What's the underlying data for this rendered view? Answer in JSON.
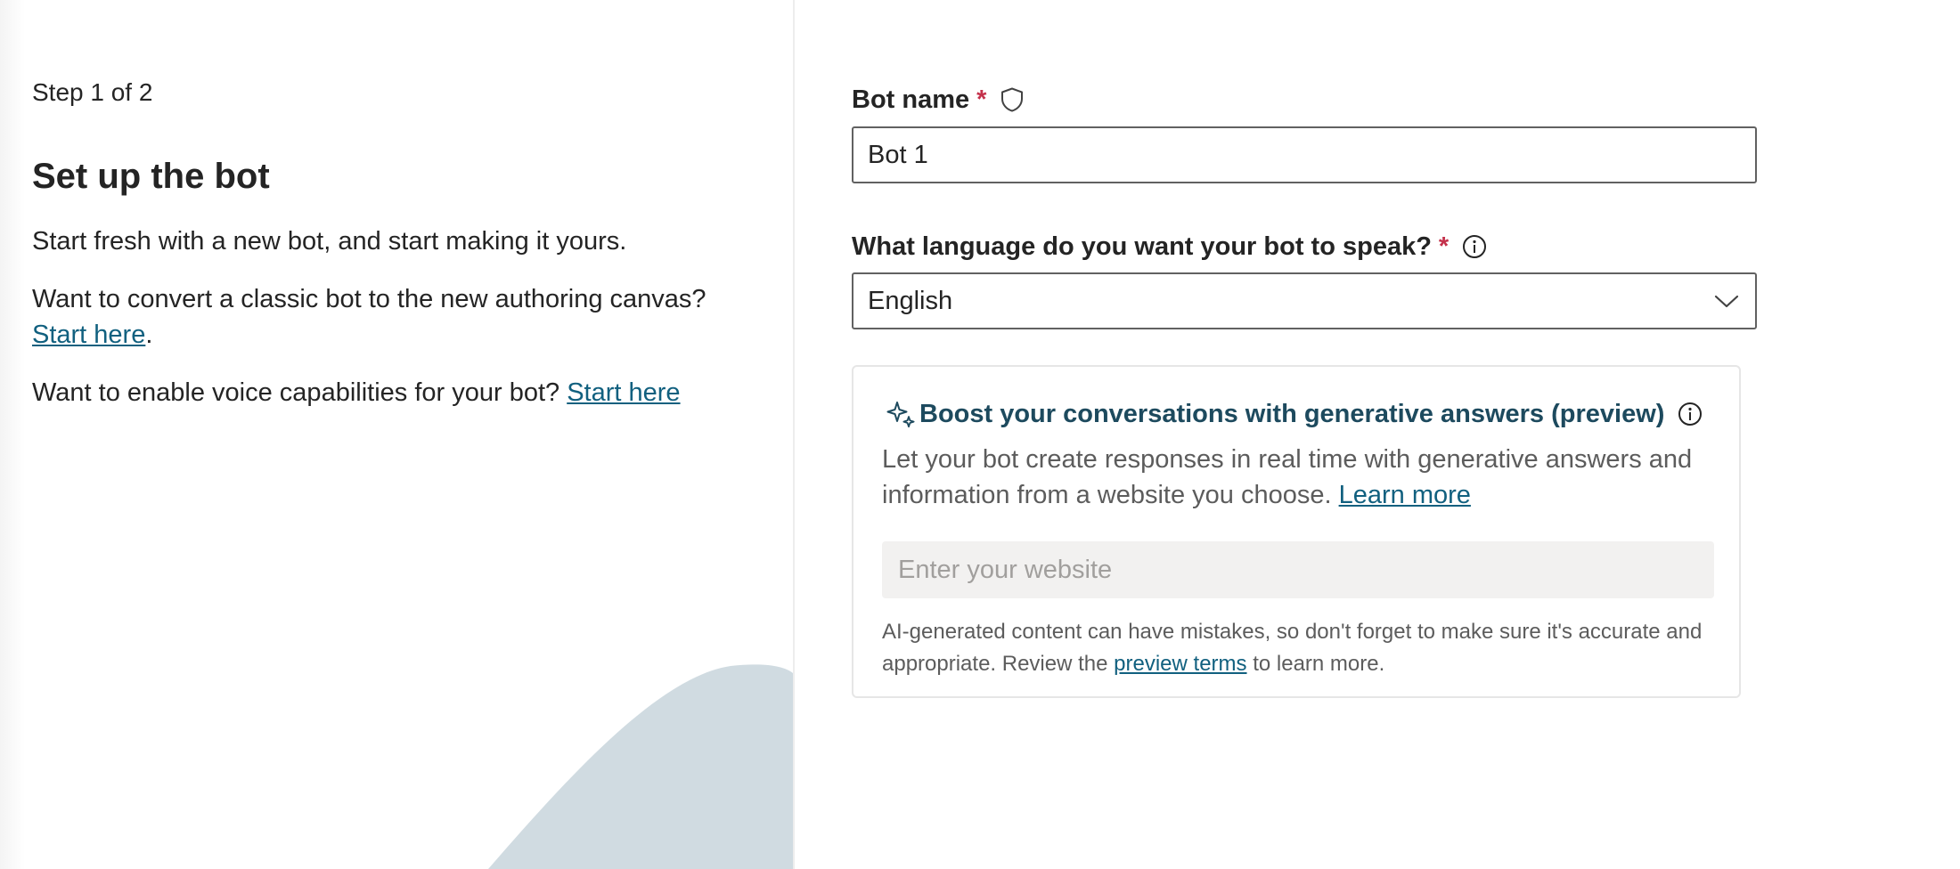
{
  "left": {
    "step_text": "Step 1 of 2",
    "title": "Set up the bot",
    "intro": "Start fresh with a new bot, and start making it yours.",
    "convert_text": "Want to convert a classic bot to the new authoring canvas?",
    "convert_link": "Start here",
    "convert_suffix": ".",
    "voice_text": "Want to enable voice capabilities for your bot?",
    "voice_link": "Start here"
  },
  "form": {
    "bot_name_label": "Bot name",
    "bot_name_required": "*",
    "bot_name_value": "Bot 1",
    "language_label": "What language do you want your bot to speak?",
    "language_required": "*",
    "language_value": "English"
  },
  "generative": {
    "title": "Boost your conversations with generative answers (preview)",
    "description": "Let your bot create responses in real time with generative answers and information from a website you choose.",
    "learn_more": "Learn more",
    "website_placeholder": "Enter your website",
    "disclaimer_prefix": "AI-generated content can have mistakes, so don't forget to make sure it's accurate and appropriate. Review the",
    "disclaimer_link": "preview terms",
    "disclaimer_suffix": "to learn more."
  },
  "icons": {
    "shield": "shield-icon",
    "info": "info-icon",
    "chevron": "chevron-down-icon",
    "sparkle": "sparkle-icon"
  },
  "colors": {
    "link": "#11607f",
    "required": "#c4314b",
    "card_title": "#1d4a5e",
    "decorative_shape": "#d0dbe1"
  }
}
